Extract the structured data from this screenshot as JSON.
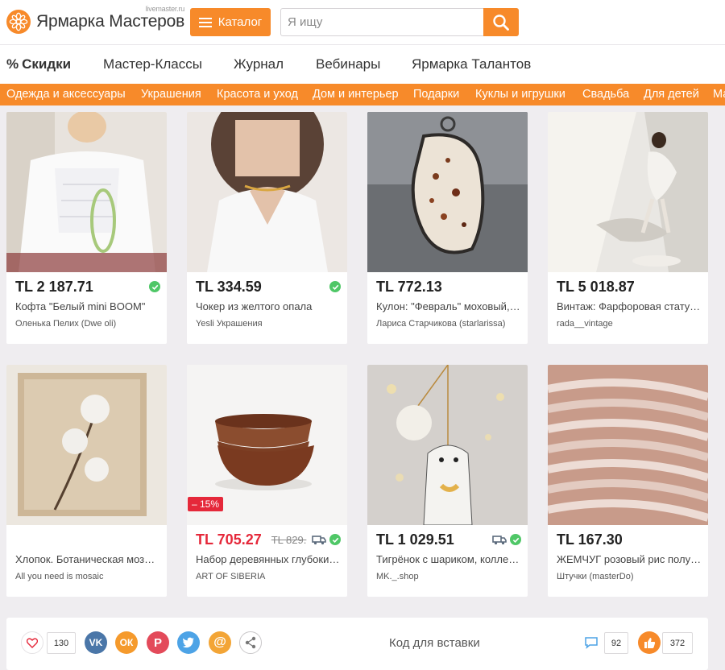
{
  "header": {
    "logo_text": "Ярмарка Мастеров",
    "logo_domain": "livemaster.ru",
    "catalog_label": "Каталог",
    "search_placeholder": "Я ищу"
  },
  "main_nav": [
    {
      "label": "Скидки",
      "icon": "percent-icon"
    },
    {
      "label": "Мастер-Классы"
    },
    {
      "label": "Журнал"
    },
    {
      "label": "Вебинары"
    },
    {
      "label": "Ярмарка Талантов"
    }
  ],
  "categories": [
    "Одежда и аксессуары",
    "Украшения",
    "Красота и уход",
    "Дом и интерьер",
    "Подарки",
    "Куклы и игрушки",
    "Свадьба",
    "Для детей",
    "Ма"
  ],
  "products": [
    {
      "price": "TL 2 187.71",
      "title": "Кофта \"Белый mini BOOM\"",
      "seller": "Оленька Пелих (Dwe oli)",
      "verified": true,
      "delivery": false,
      "sale": false,
      "old_price": "",
      "discount": ""
    },
    {
      "price": "TL 334.59",
      "title": "Чокер из желтого опала",
      "seller": "Yesli Украшения",
      "verified": true,
      "delivery": false,
      "sale": false,
      "old_price": "",
      "discount": ""
    },
    {
      "price": "TL 772.13",
      "title": "Кулон: \"Февраль\" моховый, …",
      "seller": "Лариса Старчикова (starlarissa)",
      "verified": false,
      "delivery": false,
      "sale": false,
      "old_price": "",
      "discount": ""
    },
    {
      "price": "TL 5 018.87",
      "title": "Винтаж: Фарфоровая статуэ…",
      "seller": "rada__vintage",
      "verified": false,
      "delivery": false,
      "sale": false,
      "old_price": "",
      "discount": ""
    },
    {
      "price": "",
      "title": "Хлопок. Ботаническая моза…",
      "seller": "All you need is mosaic",
      "verified": false,
      "delivery": false,
      "sale": false,
      "old_price": "",
      "discount": ""
    },
    {
      "price": "TL 705.27",
      "title": "Набор деревянных глубоких…",
      "seller": "ART OF SIBERIA",
      "verified": true,
      "delivery": true,
      "sale": true,
      "old_price": "TL 829.",
      "discount": "– 15%"
    },
    {
      "price": "TL 1 029.51",
      "title": "Тигрёнок с шариком, колле…",
      "seller": "MK._.shop",
      "verified": true,
      "delivery": true,
      "sale": false,
      "old_price": "",
      "discount": ""
    },
    {
      "price": "TL 167.30",
      "title": "ЖЕМЧУГ розовый рис полу…",
      "seller": "Штучки (masterDo)",
      "verified": false,
      "delivery": false,
      "sale": false,
      "old_price": "",
      "discount": ""
    }
  ],
  "share": {
    "like_count": "130",
    "embed_label": "Код для вставки",
    "comments_count": "92",
    "thumbs_count": "372",
    "vk_label": "VK",
    "ok_label": "ОК",
    "pinterest_label": "P",
    "mail_label": "@"
  },
  "colors": {
    "brand_orange": "#f78a2a",
    "sale_red": "#e5283a",
    "verified_green": "#4fc767"
  }
}
